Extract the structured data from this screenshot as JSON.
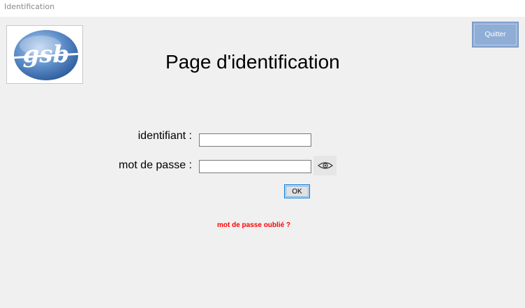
{
  "window": {
    "title": "Identification"
  },
  "header": {
    "logo_text": "gsb",
    "page_title": "Page d'identification",
    "quit_label": "Quitter"
  },
  "form": {
    "identifiant_label": "identifiant :",
    "identifiant_value": "",
    "password_label": "mot de passe :",
    "password_value": "",
    "reveal_icon": "eye-icon",
    "ok_label": "OK",
    "forgot_label": "mot de passe oublié ?"
  },
  "colors": {
    "background": "#f0f0f0",
    "quit_button": "#8fadd5",
    "forgot_link": "#ff0000",
    "focus_border": "#0078d7"
  }
}
